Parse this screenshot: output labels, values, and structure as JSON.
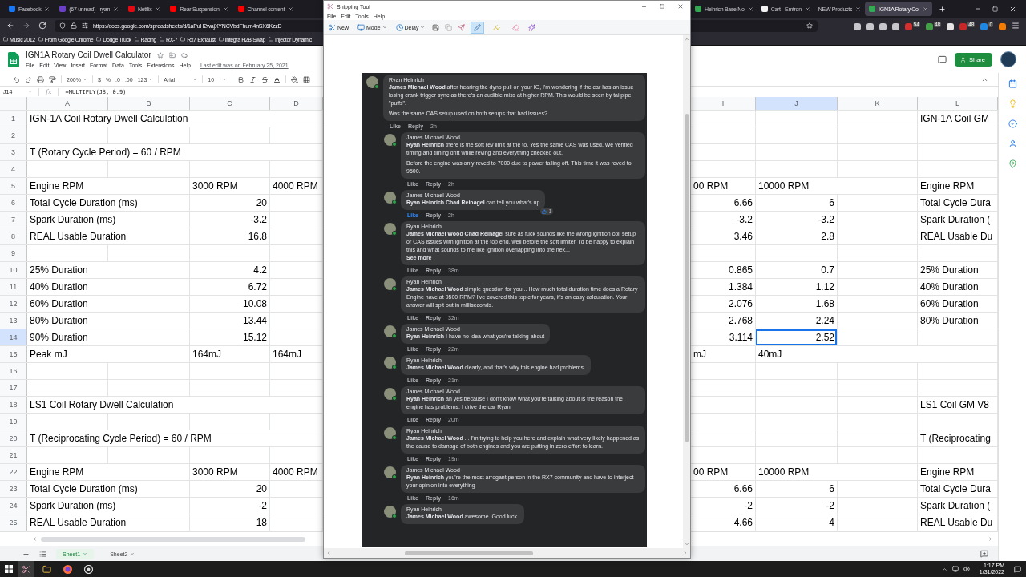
{
  "browser": {
    "tabs_left": [
      {
        "title": "Facebook",
        "selected": false,
        "color": "#1877f2"
      },
      {
        "title": "(67 unread) - ryan",
        "selected": false,
        "color": "#6c3fc9"
      },
      {
        "title": "Netflix",
        "selected": false,
        "color": "#e50914"
      },
      {
        "title": "Rear Suspension",
        "selected": false,
        "color": "#ff0000"
      },
      {
        "title": "Channel content",
        "selected": false,
        "color": "#ff0000"
      }
    ],
    "tabs_right": [
      {
        "title": "Heinrich Base No",
        "selected": false,
        "color": "#34a853"
      },
      {
        "title": "Cart - Emtron",
        "selected": false,
        "color": "#f2f2f2"
      },
      {
        "title": "NEW Products",
        "selected": false
      },
      {
        "title": "IGN1A Rotary Coi",
        "selected": true,
        "color": "#34a853"
      }
    ],
    "url": "https://docs.google.com/spreadsheets/d/1aPuH2wajXYNCVbdFhum4nSX6KzzD",
    "extensions": [
      {
        "color": "#c8c8cc"
      },
      {
        "color": "#c8c8cc"
      },
      {
        "color": "#c8c8cc"
      },
      {
        "color": "#c8c8cc"
      },
      {
        "color": "#d32f2f",
        "badge": "54"
      },
      {
        "color": "#43a047",
        "badge": "48"
      },
      {
        "color": "#e6e6e6"
      },
      {
        "color": "#c62828",
        "badge": "48"
      },
      {
        "color": "#1e88e5",
        "badge": "0"
      },
      {
        "color": "#f57c00"
      }
    ],
    "bookmarks": [
      "Music 2012",
      "From Google Chrome",
      "Dodge Truck",
      "Racing",
      "RX-7",
      "Rx7 Exhaust",
      "Integra H2B Swap",
      "Injector Dynamic"
    ]
  },
  "sheets": {
    "title": "IGN1A Rotary Coil Dwell Calculator",
    "menu": [
      "File",
      "Edit",
      "View",
      "Insert",
      "Format",
      "Data",
      "Tools",
      "Extensions",
      "Help"
    ],
    "last_edit": "Last edit was on February 25, 2021",
    "share": "Share",
    "toolbar": {
      "zoom": "200%",
      "currency": "$",
      "percent": "%",
      "decimal_less": ".0",
      "decimal_more": ".00",
      "number_format": "123",
      "font": "Arial",
      "font_size": "10"
    },
    "formula_bar": {
      "cell": "J14",
      "fx": "fx",
      "formula": "=MULTIPLY(J8, 0.9)"
    },
    "columns_left": [
      "A",
      "B",
      "C",
      "D"
    ],
    "columns_right": [
      "I",
      "J",
      "K",
      "L"
    ],
    "rows": [
      {
        "number": "1",
        "cells": {
          "col_1": {
            "kind": "text",
            "text": "IGN-1A Coil Rotary Dwell Calculation",
            "selected": false
          },
          "col_8": {
            "kind": "text",
            "text": "IGN-1A Coil GM",
            "selected": false
          }
        }
      },
      {
        "number": "2"
      },
      {
        "number": "3",
        "cells": {
          "col_1": {
            "kind": "text",
            "text": "T (Rotary Cycle Period) = 60 / RPM",
            "selected": false
          }
        }
      },
      {
        "number": "4"
      },
      {
        "number": "5",
        "cells": {
          "col_1": {
            "kind": "text",
            "text": "Engine RPM",
            "selected": false
          },
          "col_3": {
            "kind": "text",
            "text": "3000 RPM",
            "selected": false
          },
          "col_4": {
            "kind": "text",
            "text": "4000 RPM",
            "selected": false
          },
          "col_5": {
            "kind": "text",
            "text": "00 RPM",
            "selected": false
          },
          "col_6": {
            "kind": "text",
            "text": "10000 RPM",
            "selected": false
          },
          "col_8": {
            "kind": "text",
            "text": "Engine RPM",
            "selected": false
          }
        }
      },
      {
        "number": "6",
        "cells": {
          "col_1": {
            "kind": "text",
            "text": "Total Cycle Duration (ms)",
            "selected": false
          },
          "col_3": {
            "kind": "number",
            "text": "20",
            "selected": false
          },
          "col_5": {
            "kind": "number",
            "text": "6.66",
            "selected": false
          },
          "col_6": {
            "kind": "number",
            "text": "6",
            "selected": false
          },
          "col_8": {
            "kind": "text",
            "text": "Total Cycle Dura",
            "selected": false
          }
        }
      },
      {
        "number": "7",
        "cells": {
          "col_1": {
            "kind": "text",
            "text": "Spark Duration (ms)",
            "selected": false
          },
          "col_3": {
            "kind": "number",
            "text": "-3.2",
            "selected": false
          },
          "col_5": {
            "kind": "number",
            "text": "-3.2",
            "selected": false
          },
          "col_6": {
            "kind": "number",
            "text": "-3.2",
            "selected": false
          },
          "col_8": {
            "kind": "text",
            "text": "Spark Duration (",
            "selected": false
          }
        }
      },
      {
        "number": "8",
        "cells": {
          "col_1": {
            "kind": "text",
            "text": "REAL Usable Duration",
            "selected": false
          },
          "col_3": {
            "kind": "number",
            "text": "16.8",
            "selected": false
          },
          "col_5": {
            "kind": "number",
            "text": "3.46",
            "selected": false
          },
          "col_6": {
            "kind": "number",
            "text": "2.8",
            "selected": false
          },
          "col_8": {
            "kind": "text",
            "text": "REAL Usable Du",
            "selected": false
          }
        }
      },
      {
        "number": "9"
      },
      {
        "number": "10",
        "cells": {
          "col_1": {
            "kind": "text",
            "text": "25% Duration",
            "selected": false
          },
          "col_3": {
            "kind": "number",
            "text": "4.2",
            "selected": false
          },
          "col_5": {
            "kind": "number",
            "text": "0.865",
            "selected": false
          },
          "col_6": {
            "kind": "number",
            "text": "0.7",
            "selected": false
          },
          "col_8": {
            "kind": "text",
            "text": "25% Duration",
            "selected": false
          }
        }
      },
      {
        "number": "11",
        "cells": {
          "col_1": {
            "kind": "text",
            "text": "40% Duration",
            "selected": false
          },
          "col_3": {
            "kind": "number",
            "text": "6.72",
            "selected": false
          },
          "col_5": {
            "kind": "number",
            "text": "1.384",
            "selected": false
          },
          "col_6": {
            "kind": "number",
            "text": "1.12",
            "selected": false
          },
          "col_8": {
            "kind": "text",
            "text": "40% Duration",
            "selected": false
          }
        }
      },
      {
        "number": "12",
        "cells": {
          "col_1": {
            "kind": "text",
            "text": "60% Duration",
            "selected": false
          },
          "col_3": {
            "kind": "number",
            "text": "10.08",
            "selected": false
          },
          "col_5": {
            "kind": "number",
            "text": "2.076",
            "selected": false
          },
          "col_6": {
            "kind": "number",
            "text": "1.68",
            "selected": false
          },
          "col_8": {
            "kind": "text",
            "text": "60% Duration",
            "selected": false
          }
        }
      },
      {
        "number": "13",
        "cells": {
          "col_1": {
            "kind": "text",
            "text": "80% Duration",
            "selected": false
          },
          "col_3": {
            "kind": "number",
            "text": "13.44",
            "selected": false
          },
          "col_5": {
            "kind": "number",
            "text": "2.768",
            "selected": false
          },
          "col_6": {
            "kind": "number",
            "text": "2.24",
            "selected": false
          },
          "col_8": {
            "kind": "text",
            "text": "80% Duration",
            "selected": false
          }
        }
      },
      {
        "number": "14",
        "cells": {
          "col_1": {
            "kind": "text",
            "text": "90% Duration",
            "selected": false
          },
          "col_3": {
            "kind": "number",
            "text": "15.12",
            "selected": false
          },
          "col_5": {
            "kind": "number",
            "text": "3.114",
            "selected": false
          },
          "col_6": {
            "kind": "number",
            "text": "2.52",
            "selected": true
          }
        }
      },
      {
        "number": "15",
        "cells": {
          "col_1": {
            "kind": "text",
            "text": "Peak mJ",
            "selected": false
          },
          "col_3": {
            "kind": "text",
            "text": "164mJ",
            "selected": false
          },
          "col_4": {
            "kind": "text",
            "text": "164mJ",
            "selected": false
          },
          "col_5": {
            "kind": "text",
            "text": "mJ",
            "selected": false
          },
          "col_6": {
            "kind": "text",
            "text": "40mJ",
            "selected": false
          }
        }
      },
      {
        "number": "16"
      },
      {
        "number": "17"
      },
      {
        "number": "18",
        "cells": {
          "col_1": {
            "kind": "text",
            "text": "LS1 Coil Rotary Dwell Calculation",
            "selected": false
          },
          "col_8": {
            "kind": "text",
            "text": "LS1 Coil GM V8",
            "selected": false
          }
        }
      },
      {
        "number": "19"
      },
      {
        "number": "20",
        "cells": {
          "col_1": {
            "kind": "text",
            "text": "T (Reciprocating Cycle Period) = 60 / RPM",
            "selected": false
          },
          "col_8": {
            "kind": "text",
            "text": "T (Reciprocating",
            "selected": false
          }
        }
      },
      {
        "number": "21"
      },
      {
        "number": "22",
        "cells": {
          "col_1": {
            "kind": "text",
            "text": "Engine RPM",
            "selected": false
          },
          "col_3": {
            "kind": "text",
            "text": "3000 RPM",
            "selected": false
          },
          "col_4": {
            "kind": "text",
            "text": "4000 RPM",
            "selected": false
          },
          "col_5": {
            "kind": "text",
            "text": "00 RPM",
            "selected": false
          },
          "col_6": {
            "kind": "text",
            "text": "10000 RPM",
            "selected": false
          },
          "col_8": {
            "kind": "text",
            "text": "Engine RPM",
            "selected": false
          }
        }
      },
      {
        "number": "23",
        "cells": {
          "col_1": {
            "kind": "text",
            "text": "Total Cycle Duration (ms)",
            "selected": false
          },
          "col_3": {
            "kind": "number",
            "text": "20",
            "selected": false
          },
          "col_5": {
            "kind": "number",
            "text": "6.66",
            "selected": false
          },
          "col_6": {
            "kind": "number",
            "text": "6",
            "selected": false
          },
          "col_8": {
            "kind": "text",
            "text": "Total Cycle Dura",
            "selected": false
          }
        }
      },
      {
        "number": "24",
        "cells": {
          "col_1": {
            "kind": "text",
            "text": "Spark Duration (ms)",
            "selected": false
          },
          "col_3": {
            "kind": "number",
            "text": "-2",
            "selected": false
          },
          "col_5": {
            "kind": "number",
            "text": "-2",
            "selected": false
          },
          "col_6": {
            "kind": "number",
            "text": "-2",
            "selected": false
          },
          "col_8": {
            "kind": "text",
            "text": "Spark Duration (",
            "selected": false
          }
        }
      },
      {
        "number": "25",
        "cells": {
          "col_1": {
            "kind": "text",
            "text": "REAL Usable Duration",
            "selected": false
          },
          "col_3": {
            "kind": "number",
            "text": "18",
            "selected": false
          },
          "col_5": {
            "kind": "number",
            "text": "4.66",
            "selected": false
          },
          "col_6": {
            "kind": "number",
            "text": "4",
            "selected": false
          },
          "col_8": {
            "kind": "text",
            "text": "REAL Usable Du",
            "selected": false
          }
        }
      }
    ],
    "sheet_tabs": [
      {
        "name": "Sheet1",
        "selected": true
      },
      {
        "name": "Sheet2",
        "selected": false
      }
    ]
  },
  "snipping_tool": {
    "title": "Snipping Tool",
    "menu": [
      "File",
      "Edit",
      "Tools",
      "Help"
    ],
    "buttons": [
      {
        "label": "New",
        "kind": "new"
      },
      {
        "label": "Mode",
        "kind": "mode"
      },
      {
        "label": "Delay",
        "kind": "delay"
      }
    ],
    "tools": [
      {
        "kind": "pen",
        "selected": true
      },
      {
        "kind": "highlighter",
        "selected": false
      },
      {
        "kind": "eraser",
        "selected": false
      }
    ],
    "comments": [
      {
        "author": "Ryan Heinrich",
        "paragraphs": [
          "**James Michael Wood** after hearing the dyno pull on your IG, I'm wondering if the car has an issue losing crank trigger sync as there's an audible miss at higher RPM. This would be seen by tailpipe \"puffs\".",
          "Was the same CAS setup used on both setups that had issues?"
        ],
        "like": "Like",
        "reply": "Reply",
        "time": "2h",
        "liked": false,
        "replies": [
          {
            "author": "James Michael Wood",
            "paragraphs": [
              "**Ryan Heinrich** there is the soft rev limit at the to. Yes the same CAS was used. We verified timing and timing drift while reving and everything checked out.",
              "Before the engine was only reved to 7000 due to power falling off. This time it was reved to 9500."
            ],
            "like": "Like",
            "reply": "Reply",
            "time": "2h",
            "liked": false
          },
          {
            "author": "James Michael Wood",
            "paragraphs": [
              "**Ryan Heinrich Chad Reinagel** can tell you what's up"
            ],
            "reactions": "1",
            "like": "Like",
            "reply": "Reply",
            "time": "2h",
            "liked": true
          },
          {
            "author": "Ryan Heinrich",
            "paragraphs": [
              "**James Michael Wood Chad Reinagel** sure as fuck sounds like the wrong ignition coil setup or CAS issues with ignition at the top end, well before the soft limiter. I'd be happy to explain this and what sounds to me like ignition overlapping into the nex..."
            ],
            "see_more": "See more",
            "like": "Like",
            "reply": "Reply",
            "time": "38m",
            "liked": false
          },
          {
            "author": "Ryan Heinrich",
            "paragraphs": [
              "**James Michael Wood** simple question for you... How much total duration time does a Rotary Engine have at 9500 RPM? I've covered this topic for years, it's an easy calculation. Your answer will spit out in milliseconds."
            ],
            "like": "Like",
            "reply": "Reply",
            "time": "32m",
            "liked": false
          },
          {
            "author": "James Michael Wood",
            "paragraphs": [
              "**Ryan Heinrich** I have no idea what you're talking about"
            ],
            "like": "Like",
            "reply": "Reply",
            "time": "22m",
            "liked": false
          },
          {
            "author": "Ryan Heinrich",
            "paragraphs": [
              "**James Michael Wood** clearly, and that's why this engine had problems."
            ],
            "like": "Like",
            "reply": "Reply",
            "time": "21m",
            "liked": false
          },
          {
            "author": "James Michael Wood",
            "paragraphs": [
              "**Ryan Heinrich** ah yes because I don't know what you're talking about is the reason the engine has problems. I drive the car Ryan."
            ],
            "like": "Like",
            "reply": "Reply",
            "time": "20m",
            "liked": false
          },
          {
            "author": "Ryan Heinrich",
            "paragraphs": [
              "**James Michael Wood** ... I'm trying to help you here and explain what very likely happened as the cause to damage of both engines and you are putting in zero effort to learn."
            ],
            "like": "Like",
            "reply": "Reply",
            "time": "19m",
            "liked": false
          },
          {
            "author": "James Michael Wood",
            "paragraphs": [
              "**Ryan Heinrich** you're the most arrogant person in the RX7 community and have to interject your opinion into everything"
            ],
            "like": "Like",
            "reply": "Reply",
            "time": "16m",
            "liked": false
          },
          {
            "author": "Ryan Heinrich",
            "paragraphs": [
              "**James Michael Wood** awesome. Good luck."
            ]
          }
        ]
      }
    ]
  },
  "taskbar": {
    "time": "1:17 PM",
    "date": "1/31/2022"
  }
}
